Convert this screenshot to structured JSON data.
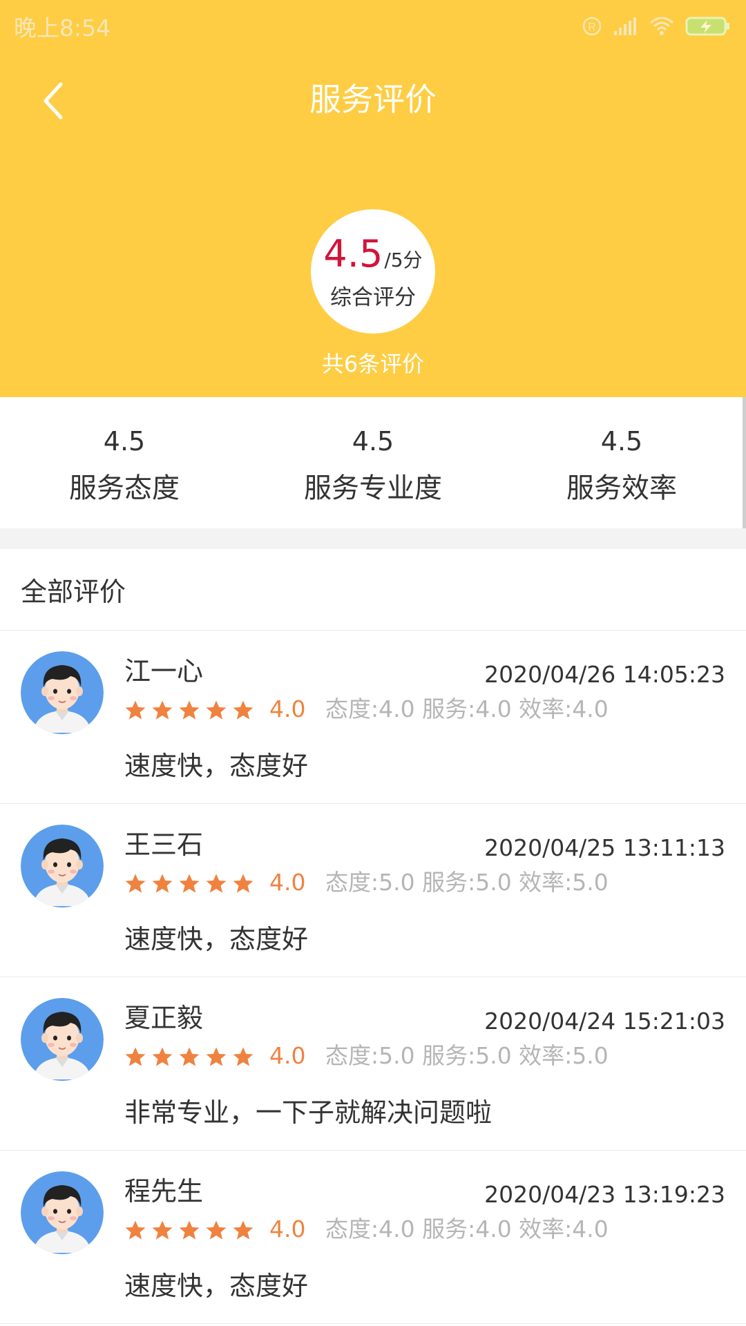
{
  "status_bar": {
    "time": "晚上8:54",
    "icons": [
      "registered-icon",
      "signal-icon",
      "wifi-icon",
      "battery-charging-icon"
    ]
  },
  "header": {
    "title": "服务评价",
    "back_icon": "chevron-left-icon",
    "background_color": "#FECD44"
  },
  "summary": {
    "score": "4.5",
    "score_suffix": "/5分",
    "score_label": "综合评分",
    "review_count": "共6条评价",
    "score_color": "#D2143A"
  },
  "sub_scores": [
    {
      "value": "4.5",
      "label": "服务态度"
    },
    {
      "value": "4.5",
      "label": "服务专业度"
    },
    {
      "value": "4.5",
      "label": "服务效率"
    }
  ],
  "section": {
    "title": "全部评价"
  },
  "star_color": "#F0823F",
  "reviews": [
    {
      "name": "江一心",
      "date": "2020/04/26 14:05:23",
      "stars": 5,
      "rating": "4.0",
      "details": "态度:4.0 服务:4.0 效率:4.0",
      "comment": "速度快，态度好"
    },
    {
      "name": "王三石",
      "date": "2020/04/25 13:11:13",
      "stars": 5,
      "rating": "4.0",
      "details": "态度:5.0 服务:5.0 效率:5.0",
      "comment": "速度快，态度好"
    },
    {
      "name": "夏正毅",
      "date": "2020/04/24 15:21:03",
      "stars": 5,
      "rating": "4.0",
      "details": "态度:5.0 服务:5.0 效率:5.0",
      "comment": "非常专业，一下子就解决问题啦"
    },
    {
      "name": "程先生",
      "date": "2020/04/23 13:19:23",
      "stars": 5,
      "rating": "4.0",
      "details": "态度:4.0 服务:4.0 效率:4.0",
      "comment": "速度快，态度好"
    }
  ]
}
